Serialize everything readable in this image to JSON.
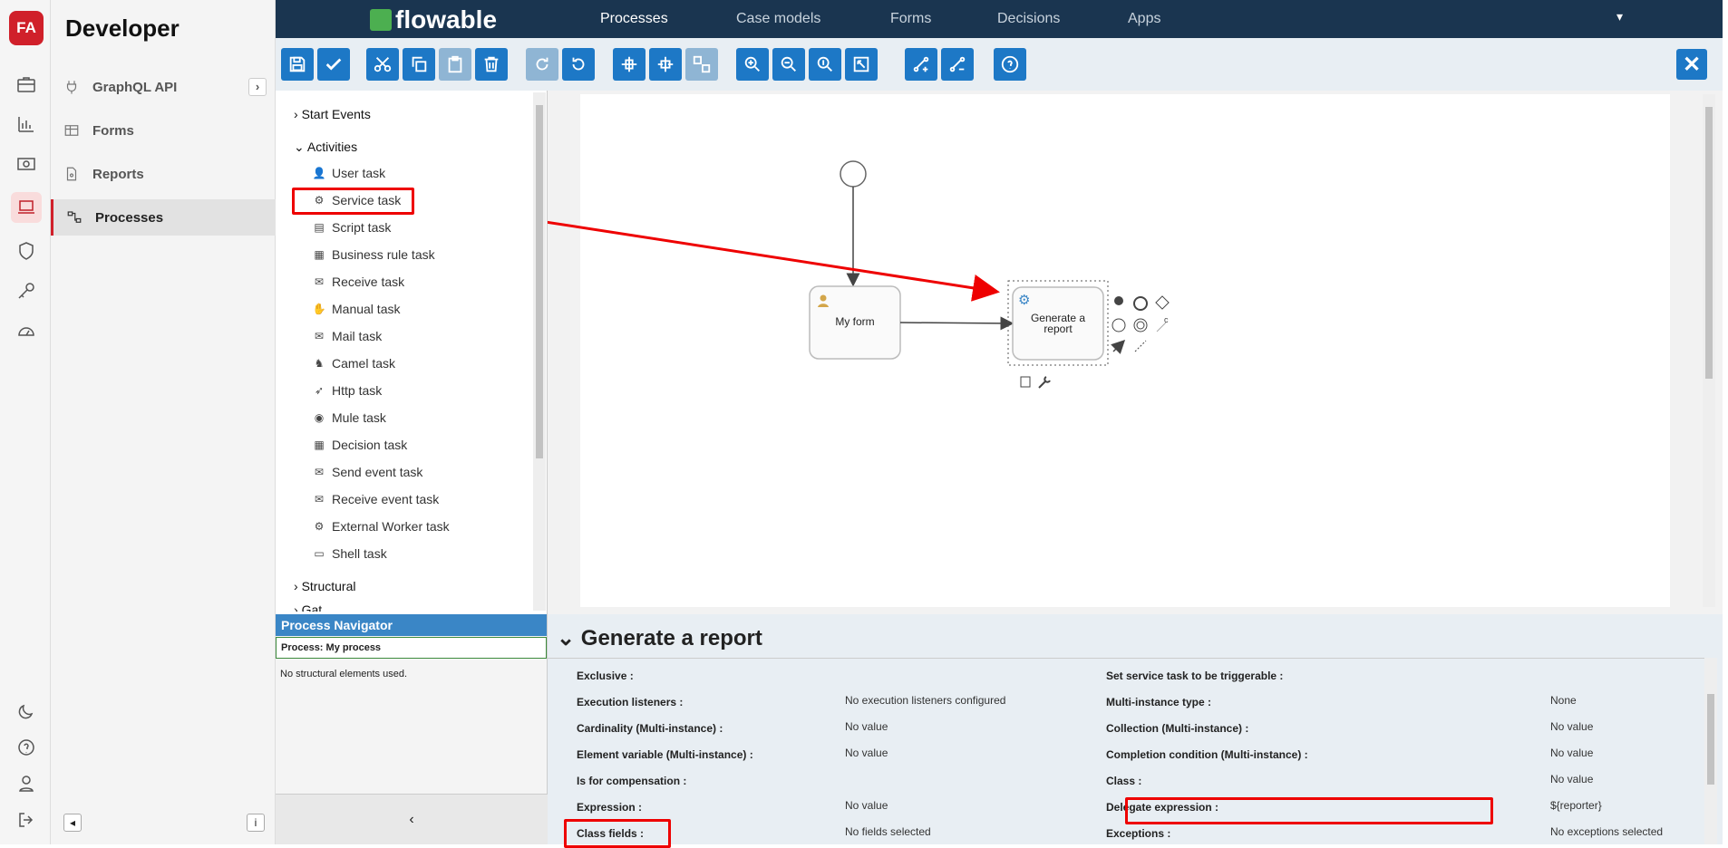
{
  "app": {
    "brand_letters": "FA",
    "title": "Developer"
  },
  "sidebar": {
    "items": [
      {
        "label": "GraphQL API",
        "icon": "plug-icon"
      },
      {
        "label": "Forms",
        "icon": "table-icon"
      },
      {
        "label": "Reports",
        "icon": "document-icon"
      },
      {
        "label": "Processes",
        "icon": "process-icon"
      }
    ]
  },
  "topbar": {
    "brand": "flowable",
    "tabs": [
      "Processes",
      "Case models",
      "Forms",
      "Decisions",
      "Apps"
    ],
    "active_tab": "Processes"
  },
  "palette": {
    "sections": {
      "start_events": "Start Events",
      "activities": "Activities",
      "structural": "Structural",
      "partial": "Gat..."
    },
    "activities": [
      {
        "label": "User task",
        "icon": "user-icon"
      },
      {
        "label": "Service task",
        "icon": "gear-icon"
      },
      {
        "label": "Script task",
        "icon": "script-icon"
      },
      {
        "label": "Business rule task",
        "icon": "table-icon"
      },
      {
        "label": "Receive task",
        "icon": "envelope-icon"
      },
      {
        "label": "Manual task",
        "icon": "hand-icon"
      },
      {
        "label": "Mail task",
        "icon": "mail-icon"
      },
      {
        "label": "Camel task",
        "icon": "camel-icon"
      },
      {
        "label": "Http task",
        "icon": "rocket-icon"
      },
      {
        "label": "Mule task",
        "icon": "mule-icon"
      },
      {
        "label": "Decision task",
        "icon": "table-icon"
      },
      {
        "label": "Send event task",
        "icon": "mail-icon"
      },
      {
        "label": "Receive event task",
        "icon": "envelope-icon"
      },
      {
        "label": "External Worker task",
        "icon": "gear-icon"
      },
      {
        "label": "Shell task",
        "icon": "terminal-icon"
      }
    ]
  },
  "navigator": {
    "header": "Process Navigator",
    "process": "Process: My process",
    "empty": "No structural elements used."
  },
  "diagram": {
    "task1": "My form",
    "task2": "Generate a report",
    "annotation_c": "c"
  },
  "properties": {
    "title": "Generate a report",
    "left": [
      {
        "label": "Exclusive :",
        "value": ""
      },
      {
        "label": "Execution listeners :",
        "value": "No execution listeners configured"
      },
      {
        "label": "Cardinality (Multi-instance) :",
        "value": "No value"
      },
      {
        "label": "Element variable (Multi-instance) :",
        "value": "No value"
      },
      {
        "label": "Is for compensation :",
        "value": ""
      },
      {
        "label": "Expression :",
        "value": "No value"
      },
      {
        "label": "Class fields :",
        "value": "No fields selected"
      }
    ],
    "right": [
      {
        "label": "Set service task to be triggerable :",
        "value": ""
      },
      {
        "label": "Multi-instance type :",
        "value": "None"
      },
      {
        "label": "Collection (Multi-instance) :",
        "value": "No value"
      },
      {
        "label": "Completion condition (Multi-instance) :",
        "value": "No value"
      },
      {
        "label": "Class :",
        "value": "No value"
      },
      {
        "label": "Delegate expression :",
        "value": "${reporter}"
      },
      {
        "label": "Exceptions :",
        "value": "No exceptions selected"
      }
    ]
  },
  "colors": {
    "accent": "#1d78c6",
    "highlight": "#e00000",
    "brand_red": "#d0202a",
    "topbar": "#1a3550"
  }
}
